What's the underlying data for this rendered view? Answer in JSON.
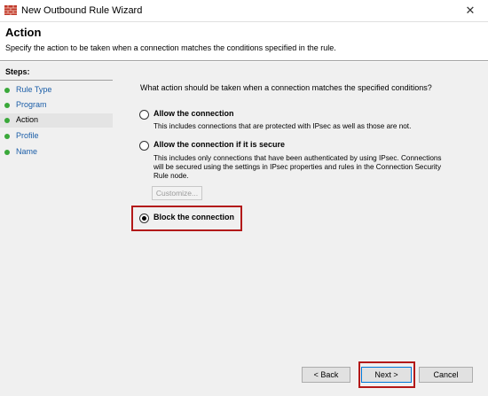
{
  "window": {
    "title": "New Outbound Rule Wizard",
    "close_glyph": "✕"
  },
  "header": {
    "title": "Action",
    "subtitle": "Specify the action to be taken when a connection matches the conditions specified in the rule."
  },
  "sidebar": {
    "title": "Steps:",
    "items": [
      {
        "label": "Rule Type"
      },
      {
        "label": "Program"
      },
      {
        "label": "Action"
      },
      {
        "label": "Profile"
      },
      {
        "label": "Name"
      }
    ]
  },
  "main": {
    "question": "What action should be taken when a connection matches the specified conditions?",
    "options": [
      {
        "label": "Allow the connection",
        "description": "This includes connections that are protected with IPsec as well as those are not.",
        "selected": false
      },
      {
        "label": "Allow the connection if it is secure",
        "description": "This includes only connections that have been authenticated by using IPsec.  Connections will be secured using the settings in IPsec properties and rules in the Connection Security Rule node.",
        "selected": false
      },
      {
        "label": "Block the connection",
        "description": "",
        "selected": true
      }
    ],
    "customize_label": "Customize..."
  },
  "footer": {
    "back_label": "< Back",
    "next_label": "Next >",
    "cancel_label": "Cancel"
  },
  "colors": {
    "highlight": "#b31919",
    "step_dot": "#3aa83a",
    "link": "#1b5ea8"
  },
  "icons": {
    "title": "firewall-wall-icon",
    "step": "green-dot-icon"
  }
}
